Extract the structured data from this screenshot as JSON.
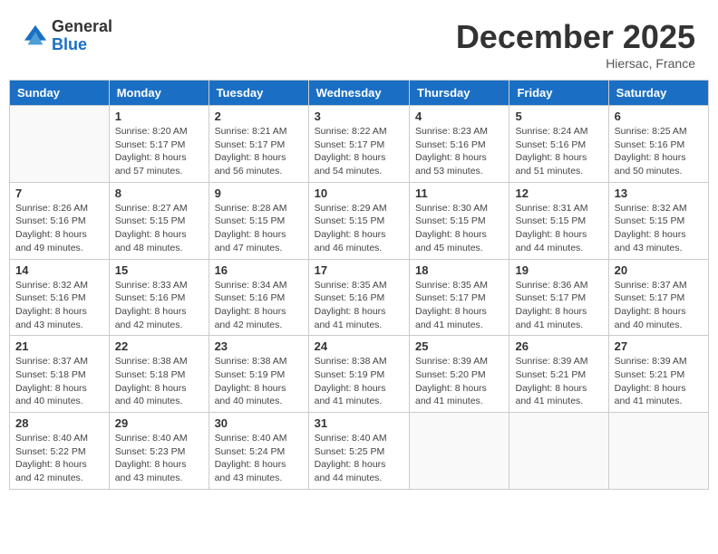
{
  "header": {
    "logo_line1": "General",
    "logo_line2": "Blue",
    "month": "December 2025",
    "location": "Hiersac, France"
  },
  "weekdays": [
    "Sunday",
    "Monday",
    "Tuesday",
    "Wednesday",
    "Thursday",
    "Friday",
    "Saturday"
  ],
  "weeks": [
    [
      {
        "day": "",
        "info": ""
      },
      {
        "day": "1",
        "info": "Sunrise: 8:20 AM\nSunset: 5:17 PM\nDaylight: 8 hours\nand 57 minutes."
      },
      {
        "day": "2",
        "info": "Sunrise: 8:21 AM\nSunset: 5:17 PM\nDaylight: 8 hours\nand 56 minutes."
      },
      {
        "day": "3",
        "info": "Sunrise: 8:22 AM\nSunset: 5:17 PM\nDaylight: 8 hours\nand 54 minutes."
      },
      {
        "day": "4",
        "info": "Sunrise: 8:23 AM\nSunset: 5:16 PM\nDaylight: 8 hours\nand 53 minutes."
      },
      {
        "day": "5",
        "info": "Sunrise: 8:24 AM\nSunset: 5:16 PM\nDaylight: 8 hours\nand 51 minutes."
      },
      {
        "day": "6",
        "info": "Sunrise: 8:25 AM\nSunset: 5:16 PM\nDaylight: 8 hours\nand 50 minutes."
      }
    ],
    [
      {
        "day": "7",
        "info": "Sunrise: 8:26 AM\nSunset: 5:16 PM\nDaylight: 8 hours\nand 49 minutes."
      },
      {
        "day": "8",
        "info": "Sunrise: 8:27 AM\nSunset: 5:15 PM\nDaylight: 8 hours\nand 48 minutes."
      },
      {
        "day": "9",
        "info": "Sunrise: 8:28 AM\nSunset: 5:15 PM\nDaylight: 8 hours\nand 47 minutes."
      },
      {
        "day": "10",
        "info": "Sunrise: 8:29 AM\nSunset: 5:15 PM\nDaylight: 8 hours\nand 46 minutes."
      },
      {
        "day": "11",
        "info": "Sunrise: 8:30 AM\nSunset: 5:15 PM\nDaylight: 8 hours\nand 45 minutes."
      },
      {
        "day": "12",
        "info": "Sunrise: 8:31 AM\nSunset: 5:15 PM\nDaylight: 8 hours\nand 44 minutes."
      },
      {
        "day": "13",
        "info": "Sunrise: 8:32 AM\nSunset: 5:15 PM\nDaylight: 8 hours\nand 43 minutes."
      }
    ],
    [
      {
        "day": "14",
        "info": "Sunrise: 8:32 AM\nSunset: 5:16 PM\nDaylight: 8 hours\nand 43 minutes."
      },
      {
        "day": "15",
        "info": "Sunrise: 8:33 AM\nSunset: 5:16 PM\nDaylight: 8 hours\nand 42 minutes."
      },
      {
        "day": "16",
        "info": "Sunrise: 8:34 AM\nSunset: 5:16 PM\nDaylight: 8 hours\nand 42 minutes."
      },
      {
        "day": "17",
        "info": "Sunrise: 8:35 AM\nSunset: 5:16 PM\nDaylight: 8 hours\nand 41 minutes."
      },
      {
        "day": "18",
        "info": "Sunrise: 8:35 AM\nSunset: 5:17 PM\nDaylight: 8 hours\nand 41 minutes."
      },
      {
        "day": "19",
        "info": "Sunrise: 8:36 AM\nSunset: 5:17 PM\nDaylight: 8 hours\nand 41 minutes."
      },
      {
        "day": "20",
        "info": "Sunrise: 8:37 AM\nSunset: 5:17 PM\nDaylight: 8 hours\nand 40 minutes."
      }
    ],
    [
      {
        "day": "21",
        "info": "Sunrise: 8:37 AM\nSunset: 5:18 PM\nDaylight: 8 hours\nand 40 minutes."
      },
      {
        "day": "22",
        "info": "Sunrise: 8:38 AM\nSunset: 5:18 PM\nDaylight: 8 hours\nand 40 minutes."
      },
      {
        "day": "23",
        "info": "Sunrise: 8:38 AM\nSunset: 5:19 PM\nDaylight: 8 hours\nand 40 minutes."
      },
      {
        "day": "24",
        "info": "Sunrise: 8:38 AM\nSunset: 5:19 PM\nDaylight: 8 hours\nand 41 minutes."
      },
      {
        "day": "25",
        "info": "Sunrise: 8:39 AM\nSunset: 5:20 PM\nDaylight: 8 hours\nand 41 minutes."
      },
      {
        "day": "26",
        "info": "Sunrise: 8:39 AM\nSunset: 5:21 PM\nDaylight: 8 hours\nand 41 minutes."
      },
      {
        "day": "27",
        "info": "Sunrise: 8:39 AM\nSunset: 5:21 PM\nDaylight: 8 hours\nand 41 minutes."
      }
    ],
    [
      {
        "day": "28",
        "info": "Sunrise: 8:40 AM\nSunset: 5:22 PM\nDaylight: 8 hours\nand 42 minutes."
      },
      {
        "day": "29",
        "info": "Sunrise: 8:40 AM\nSunset: 5:23 PM\nDaylight: 8 hours\nand 43 minutes."
      },
      {
        "day": "30",
        "info": "Sunrise: 8:40 AM\nSunset: 5:24 PM\nDaylight: 8 hours\nand 43 minutes."
      },
      {
        "day": "31",
        "info": "Sunrise: 8:40 AM\nSunset: 5:25 PM\nDaylight: 8 hours\nand 44 minutes."
      },
      {
        "day": "",
        "info": ""
      },
      {
        "day": "",
        "info": ""
      },
      {
        "day": "",
        "info": ""
      }
    ]
  ]
}
